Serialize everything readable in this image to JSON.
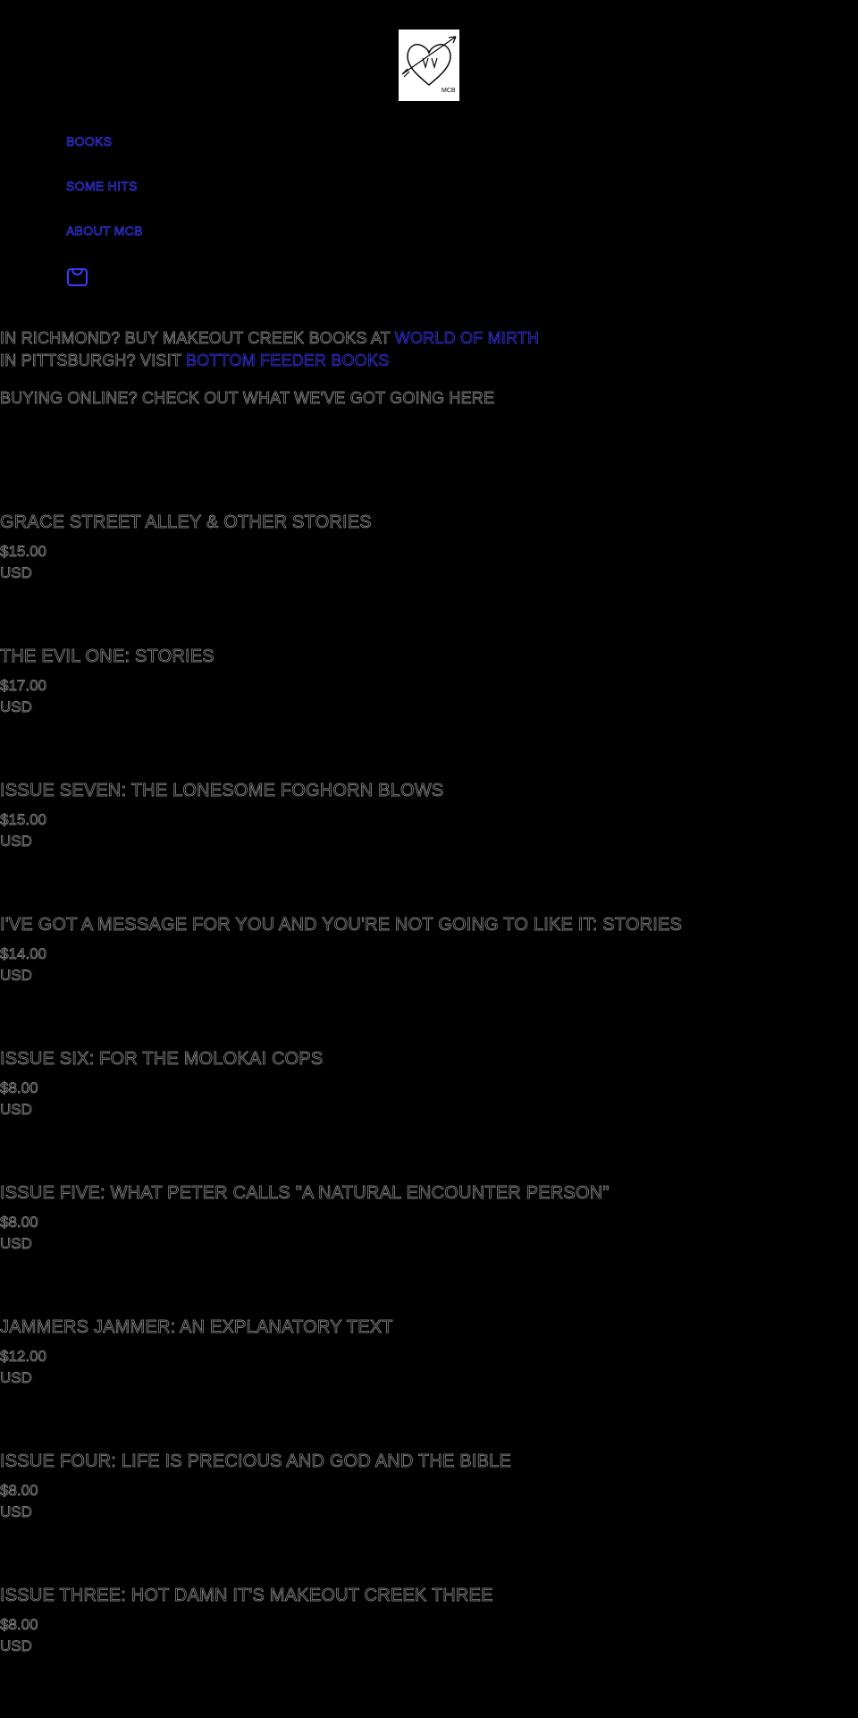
{
  "logo": {
    "initials": "MCB",
    "alt": "Makeout Creek Books logo"
  },
  "nav": {
    "items": [
      {
        "label": "BOOKS"
      },
      {
        "label": "SOME HITS"
      },
      {
        "label": "ABOUT MCB"
      }
    ],
    "cart_icon": "shopping-bag-icon"
  },
  "notice": {
    "richmond_prefix": "IN RICHMOND? BUY MAKEOUT CREEK BOOKS AT ",
    "richmond_link": "WORLD OF MIRTH",
    "pittsburgh_prefix": "IN PITTSBURGH? VISIT ",
    "pittsburgh_link": "BOTTOM FEEDER BOOKS",
    "online": "BUYING ONLINE? CHECK OUT WHAT WE'VE GOT GOING HERE"
  },
  "products": [
    {
      "title": "GRACE STREET ALLEY & OTHER STORIES",
      "price": "$15.00",
      "currency": "USD"
    },
    {
      "title": "THE EVIL ONE: STORIES",
      "price": "$17.00",
      "currency": "USD"
    },
    {
      "title": "ISSUE SEVEN: THE LONESOME FOGHORN BLOWS",
      "price": "$15.00",
      "currency": "USD"
    },
    {
      "title": "I'VE GOT A MESSAGE FOR YOU AND YOU'RE NOT GOING TO LIKE IT: STORIES",
      "price": "$14.00",
      "currency": "USD"
    },
    {
      "title": "ISSUE SIX: FOR THE MOLOKAI COPS",
      "price": "$8.00",
      "currency": "USD"
    },
    {
      "title": "ISSUE FIVE: WHAT PETER CALLS \"A NATURAL ENCOUNTER PERSON\"",
      "price": "$8.00",
      "currency": "USD"
    },
    {
      "title": "JAMMERS JAMMER: AN EXPLANATORY TEXT",
      "price": "$12.00",
      "currency": "USD"
    },
    {
      "title": "ISSUE FOUR: LIFE IS PRECIOUS AND GOD AND THE BIBLE",
      "price": "$8.00",
      "currency": "USD"
    },
    {
      "title": "ISSUE THREE: HOT DAMN IT'S MAKEOUT CREEK THREE",
      "price": "$8.00",
      "currency": "USD"
    }
  ],
  "colors": {
    "background": "#000000",
    "link": "#3b3bff",
    "text_outline": "#9a9a9a"
  }
}
